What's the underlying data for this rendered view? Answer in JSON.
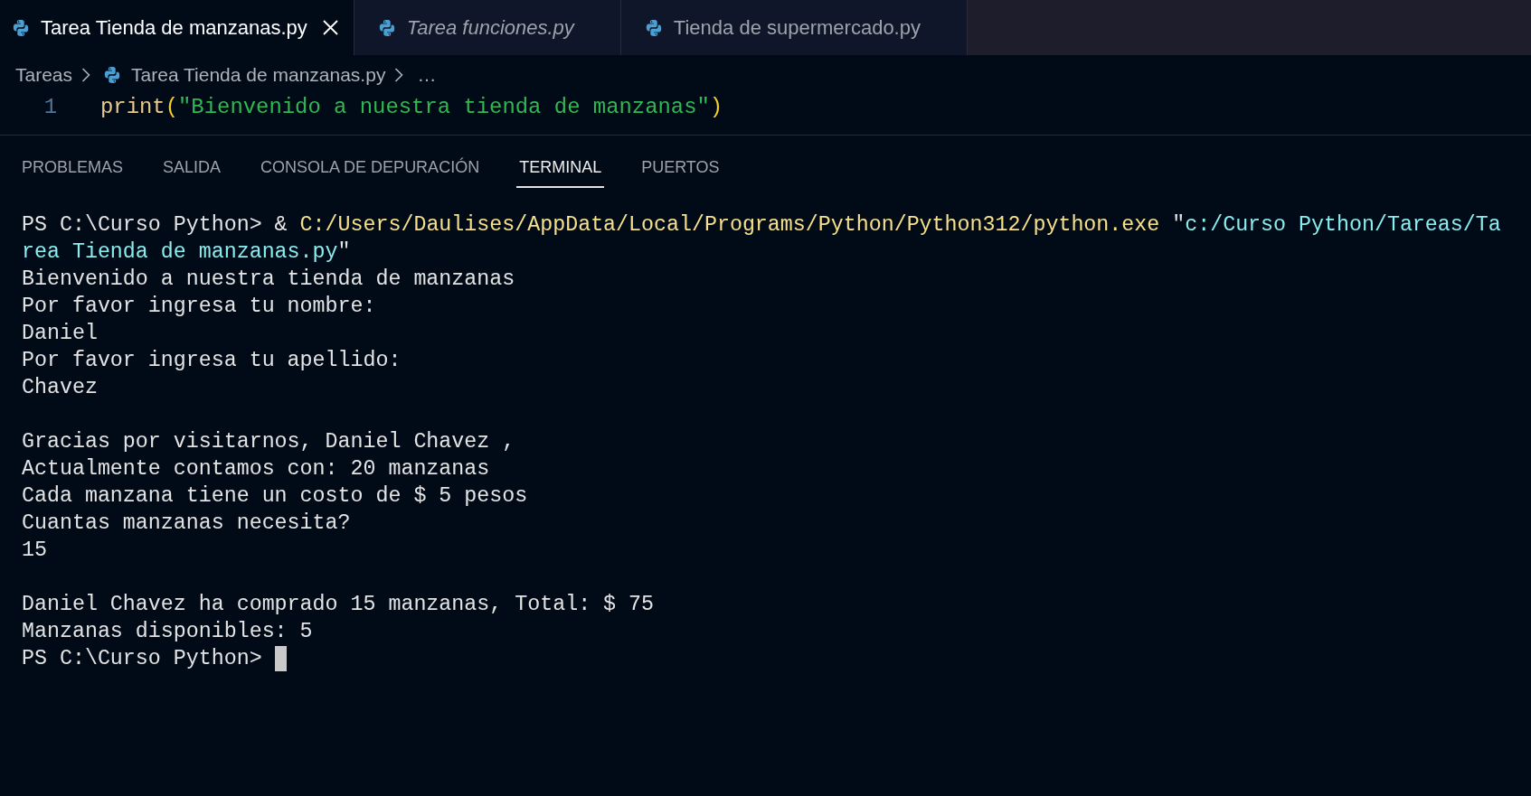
{
  "editor_tabs": [
    {
      "label": "Tarea Tienda de manzanas.py",
      "selected": true,
      "preview": false
    },
    {
      "label": "Tarea funciones.py",
      "selected": false,
      "preview": true
    },
    {
      "label": "Tienda de supermercado.py",
      "selected": false,
      "preview": false
    }
  ],
  "breadcrumb": [
    {
      "kind": "folder",
      "label": "Tareas"
    },
    {
      "kind": "file",
      "label": "Tarea Tienda de manzanas.py"
    },
    {
      "kind": "more",
      "label": "…"
    }
  ],
  "editor": {
    "lines": [
      {
        "number": "1",
        "tokens": [
          {
            "kind": "function",
            "text": "print"
          },
          {
            "kind": "bracket",
            "text": "("
          },
          {
            "kind": "string",
            "text": "\"Bienvenido a nuestra tienda de manzanas\""
          },
          {
            "kind": "bracket",
            "text": ")"
          }
        ]
      }
    ]
  },
  "panel_tabs": [
    {
      "label": "PROBLEMAS",
      "selected": false
    },
    {
      "label": "SALIDA",
      "selected": false
    },
    {
      "label": "CONSOLA DE DEPURACIÓN",
      "selected": false
    },
    {
      "label": "TERMINAL",
      "selected": true
    },
    {
      "label": "PUERTOS",
      "selected": false
    }
  ],
  "terminal": {
    "cursor": true,
    "blocks": [
      {
        "lines": [
          {
            "segments": [
              {
                "kind": "plain",
                "text": "PS C:\\Curso Python> & "
              },
              {
                "kind": "command",
                "text": "C:/Users/Daulises/AppData/Local/Programs/Python/Python312/python.exe"
              },
              {
                "kind": "plain",
                "text": " \""
              },
              {
                "kind": "string",
                "text": "c:/Curso Python/Tareas/Ta"
              }
            ]
          },
          {
            "segments": [
              {
                "kind": "string",
                "text": "rea Tienda de manzanas.py"
              },
              {
                "kind": "plain",
                "text": "\""
              }
            ]
          },
          {
            "segments": [
              {
                "kind": "plain",
                "text": "Bienvenido a nuestra tienda de manzanas"
              }
            ]
          },
          {
            "segments": [
              {
                "kind": "plain",
                "text": "Por favor ingresa tu nombre:"
              }
            ]
          },
          {
            "segments": [
              {
                "kind": "plain",
                "text": "Daniel"
              }
            ]
          },
          {
            "segments": [
              {
                "kind": "plain",
                "text": "Por favor ingresa tu apellido:"
              }
            ]
          },
          {
            "segments": [
              {
                "kind": "plain",
                "text": "Chavez"
              }
            ]
          }
        ]
      },
      {
        "lines": [
          {
            "segments": [
              {
                "kind": "plain",
                "text": "Gracias por visitarnos, Daniel Chavez ,"
              }
            ]
          },
          {
            "segments": [
              {
                "kind": "plain",
                "text": "Actualmente contamos con: 20 manzanas"
              }
            ]
          },
          {
            "segments": [
              {
                "kind": "plain",
                "text": "Cada manzana tiene un costo de $ 5 pesos"
              }
            ]
          },
          {
            "segments": [
              {
                "kind": "plain",
                "text": "Cuantas manzanas necesita?"
              }
            ]
          },
          {
            "segments": [
              {
                "kind": "plain",
                "text": "15"
              }
            ]
          }
        ]
      },
      {
        "lines": [
          {
            "segments": [
              {
                "kind": "plain",
                "text": "Daniel Chavez ha comprado 15 manzanas, Total: $ 75"
              }
            ]
          },
          {
            "segments": [
              {
                "kind": "plain",
                "text": "Manzanas disponibles: 5"
              }
            ]
          },
          {
            "segments": [
              {
                "kind": "plain",
                "text": "PS C:\\Curso Python> "
              }
            ]
          }
        ]
      }
    ]
  }
}
